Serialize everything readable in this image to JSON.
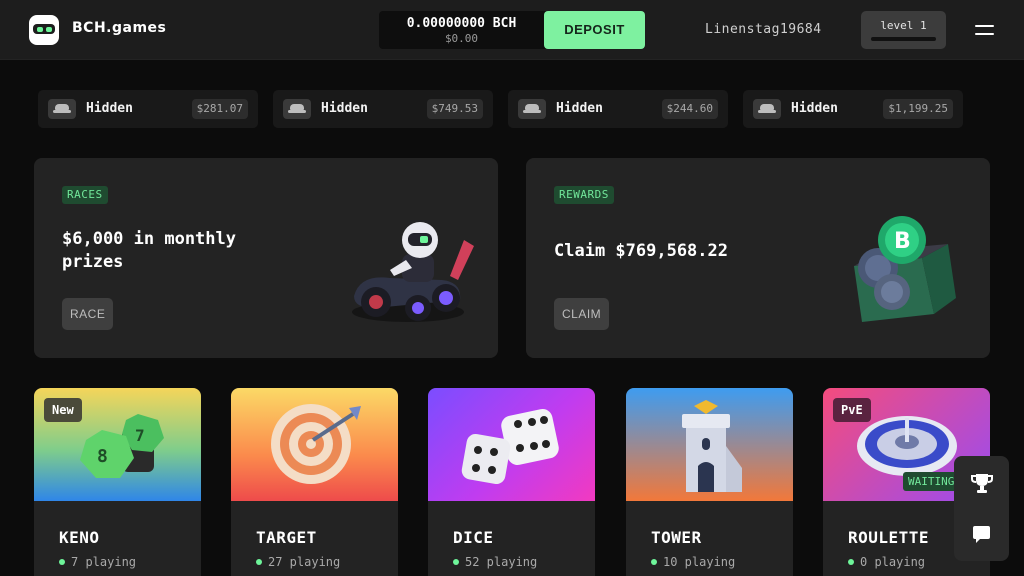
{
  "header": {
    "brand": "BCH.games",
    "balance": "0.00000000 BCH",
    "balance_usd": "$0.00",
    "deposit_label": "DEPOSIT",
    "username": "Linenstag19684",
    "level_label": "level 1",
    "level_progress": 0,
    "accent_color": "#7ef1a0"
  },
  "recent_wins": [
    {
      "name": "Hidden",
      "amount": "$281.07"
    },
    {
      "name": "Hidden",
      "amount": "$749.53"
    },
    {
      "name": "Hidden",
      "amount": "$244.60"
    },
    {
      "name": "Hidden",
      "amount": "$1,199.25"
    }
  ],
  "promos": {
    "races": {
      "tag": "RACES",
      "title_line1": "$6,000 in monthly",
      "title_line2": "prizes",
      "button": "RACE"
    },
    "rewards": {
      "tag": "REWARDS",
      "title": "Claim $769,568.22",
      "button": "CLAIM"
    }
  },
  "games": [
    {
      "name": "KENO",
      "players": "7 playing",
      "badge": "New"
    },
    {
      "name": "TARGET",
      "players": "27 playing"
    },
    {
      "name": "DICE",
      "players": "52 playing"
    },
    {
      "name": "TOWER",
      "players": "10 playing"
    },
    {
      "name": "ROULETTE",
      "players": "0 playing",
      "badge": "PvE",
      "status": "WAITING"
    }
  ],
  "icons": {
    "logo": "robot-face-icon",
    "win": "incognito-icon",
    "menu": "hamburger-menu-icon",
    "leaderboard": "trophy-icon",
    "chat": "chat-bubble-icon"
  }
}
